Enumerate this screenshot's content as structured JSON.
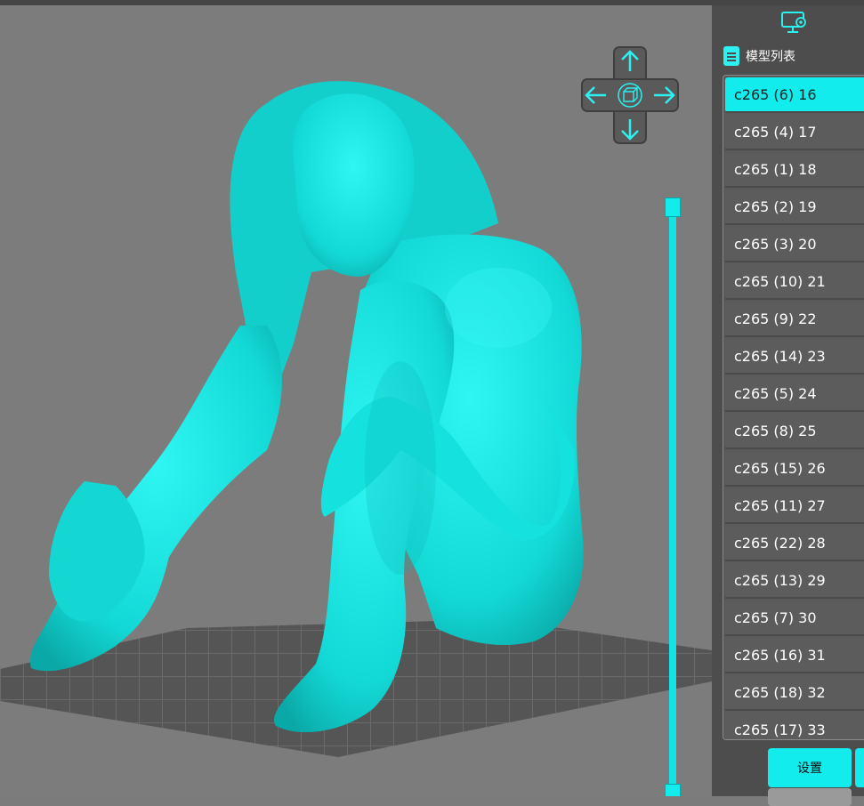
{
  "sidebar": {
    "list_title": "模型列表",
    "models": [
      {
        "label": "c265 (6)  16",
        "selected": true
      },
      {
        "label": "c265 (4)  17"
      },
      {
        "label": "c265 (1)  18"
      },
      {
        "label": "c265 (2)  19"
      },
      {
        "label": "c265 (3)  20"
      },
      {
        "label": "c265 (10)  21"
      },
      {
        "label": "c265 (9)  22"
      },
      {
        "label": "c265 (14)  23"
      },
      {
        "label": "c265 (5)  24"
      },
      {
        "label": "c265 (8)  25"
      },
      {
        "label": "c265 (15)  26"
      },
      {
        "label": "c265 (11)  27"
      },
      {
        "label": "c265 (22)  28"
      },
      {
        "label": "c265 (13)  29"
      },
      {
        "label": "c265 (7)  30"
      },
      {
        "label": "c265 (16)  31"
      },
      {
        "label": "c265 (18)  32"
      },
      {
        "label": "c265 (17)  33"
      }
    ],
    "settings_button": "设置"
  },
  "icons": {
    "settings": "monitor-gear-icon",
    "list": "document-icon",
    "nav_up": "arrow-up-icon",
    "nav_down": "arrow-down-icon",
    "nav_left": "arrow-left-icon",
    "nav_right": "arrow-right-icon",
    "nav_center": "cube-icon"
  },
  "colors": {
    "accent": "#13ecec",
    "model": "#12dcdc",
    "background": "#7c7c7c",
    "panel": "#4d4d4d"
  },
  "layer_slider": {
    "min": 0,
    "max": 1
  }
}
